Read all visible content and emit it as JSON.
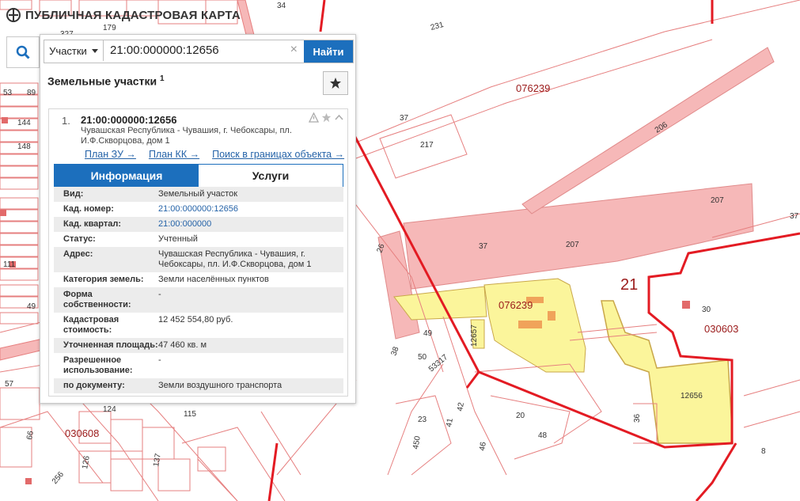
{
  "app": {
    "title": "ПУБЛИЧНАЯ КАДАСТРОВАЯ КАРТА"
  },
  "search": {
    "type_label": "Участки",
    "query": "21:00:000000:12656",
    "clear_icon": "×",
    "button_label": "Найти"
  },
  "results": {
    "title": "Земельные участки",
    "count": "1"
  },
  "item": {
    "index": "1.",
    "cad_number": "21:00:000000:12656",
    "address": "Чувашская Республика - Чувашия, г. Чебоксары, пл. И.Ф.Скворцова, дом 1",
    "links": [
      "План ЗУ →",
      "План КК →",
      "Поиск в границах объекта →"
    ]
  },
  "tabs": [
    "Информация",
    "Услуги"
  ],
  "properties": [
    {
      "k": "Вид:",
      "v": "Земельный участок"
    },
    {
      "k": "Кад. номер:",
      "v": "21:00:000000:12656",
      "link": true
    },
    {
      "k": "Кад. квартал:",
      "v": "21:00:000000",
      "link": true
    },
    {
      "k": "Статус:",
      "v": "Учтенный"
    },
    {
      "k": "Адрес:",
      "v": "Чувашская Республика - Чувашия, г. Чебоксары, пл. И.Ф.Скворцова, дом 1"
    },
    {
      "k": "Категория земель:",
      "v": "Земли населённых пунктов"
    },
    {
      "k": "Форма собственности:",
      "v": "-"
    },
    {
      "k": "Кадастровая стоимость:",
      "v": "12 452 554,80 руб."
    },
    {
      "k": "Уточненная площадь:",
      "v": "47 460 кв. м"
    },
    {
      "k": "Разрешенное использование:",
      "v": "-"
    },
    {
      "k": "по документу:",
      "v": "Земли воздушного транспорта"
    }
  ],
  "map_labels": {
    "quarter_main": "076239",
    "quarter_main_yellow": "076239",
    "quarter_right": "030603",
    "quarter_left": "030608",
    "district": "21",
    "parcel_target": "12656",
    "runway_a": "207",
    "runway_b": "207",
    "road_206": "206",
    "n_231": "231",
    "n_34": "34",
    "n_37a": "37",
    "n_37b": "37",
    "n_37c": "37",
    "n_217": "217",
    "n_26": "26",
    "n_49": "49",
    "n_50": "50",
    "n_38": "38",
    "n_53317": "53317",
    "n_12657": "12657",
    "n_30": "30",
    "n_36": "36",
    "n_42": "42",
    "n_41": "41",
    "n_23": "23",
    "n_20": "20",
    "n_48": "48",
    "n_46": "46",
    "n_450": "450",
    "n_8": "8",
    "n_124": "124",
    "n_126": "126",
    "n_137": "137",
    "n_256": "256",
    "n_144": "144",
    "n_148": "148",
    "n_111": "111",
    "n_89": "89",
    "n_53": "53",
    "n_57": "57",
    "n_66": "66",
    "n_179": "179",
    "n_327": "327",
    "n_115": "115",
    "n_49b": "49"
  },
  "colors": {
    "accent": "#1c6fbd",
    "border_red": "#e31b23",
    "parcel_pink": "#f6b8b8",
    "parcel_yellow": "#fbf59b"
  }
}
